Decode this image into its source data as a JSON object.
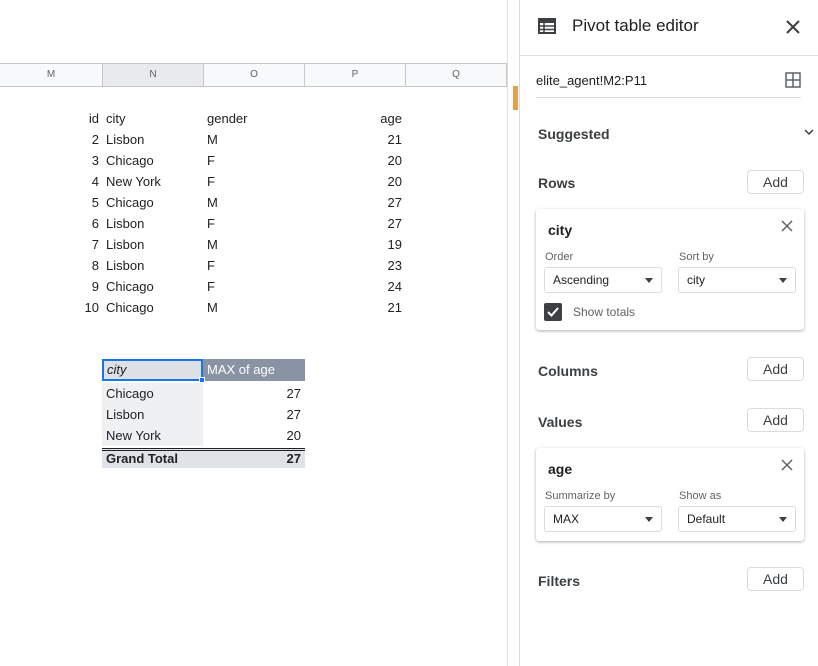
{
  "sheet": {
    "columns": [
      "M",
      "N",
      "O",
      "P",
      "Q"
    ],
    "headers": {
      "id": "id",
      "city": "city",
      "gender": "gender",
      "age": "age"
    },
    "rows": [
      {
        "id": "2",
        "city": "Lisbon",
        "gender": "M",
        "age": "21"
      },
      {
        "id": "3",
        "city": "Chicago",
        "gender": "F",
        "age": "20"
      },
      {
        "id": "4",
        "city": "New York",
        "gender": "F",
        "age": "20"
      },
      {
        "id": "5",
        "city": "Chicago",
        "gender": "M",
        "age": "27"
      },
      {
        "id": "6",
        "city": "Lisbon",
        "gender": "F",
        "age": "27"
      },
      {
        "id": "7",
        "city": "Lisbon",
        "gender": "M",
        "age": "19"
      },
      {
        "id": "8",
        "city": "Lisbon",
        "gender": "F",
        "age": "23"
      },
      {
        "id": "9",
        "city": "Chicago",
        "gender": "F",
        "age": "24"
      },
      {
        "id": "10",
        "city": "Chicago",
        "gender": "M",
        "age": "21"
      }
    ],
    "pivot": {
      "header_city": "city",
      "header_value": "MAX of age",
      "rows": [
        {
          "city": "Chicago",
          "value": "27"
        },
        {
          "city": "Lisbon",
          "value": "27"
        },
        {
          "city": "New York",
          "value": "20"
        }
      ],
      "total_label": "Grand Total",
      "total_value": "27"
    }
  },
  "editor": {
    "title": "Pivot table editor",
    "title_icon": "table-icon",
    "close_icon": "close-icon",
    "range": "elite_agent!M2:P11",
    "range_icon": "grid-select-icon",
    "suggested_label": "Suggested",
    "rows_label": "Rows",
    "columns_label": "Columns",
    "values_label": "Values",
    "filters_label": "Filters",
    "add_label": "Add",
    "row_card": {
      "title": "city",
      "order_label": "Order",
      "order_value": "Ascending",
      "sortby_label": "Sort by",
      "sortby_value": "city",
      "show_totals_label": "Show totals",
      "show_totals_checked": true
    },
    "value_card": {
      "title": "age",
      "summarize_label": "Summarize by",
      "summarize_value": "MAX",
      "showas_label": "Show as",
      "showas_value": "Default"
    }
  },
  "colors": {
    "accent": "#1a73e8",
    "pivot_header": "#8a93a3",
    "scroll_thumb": "#e6a049"
  }
}
